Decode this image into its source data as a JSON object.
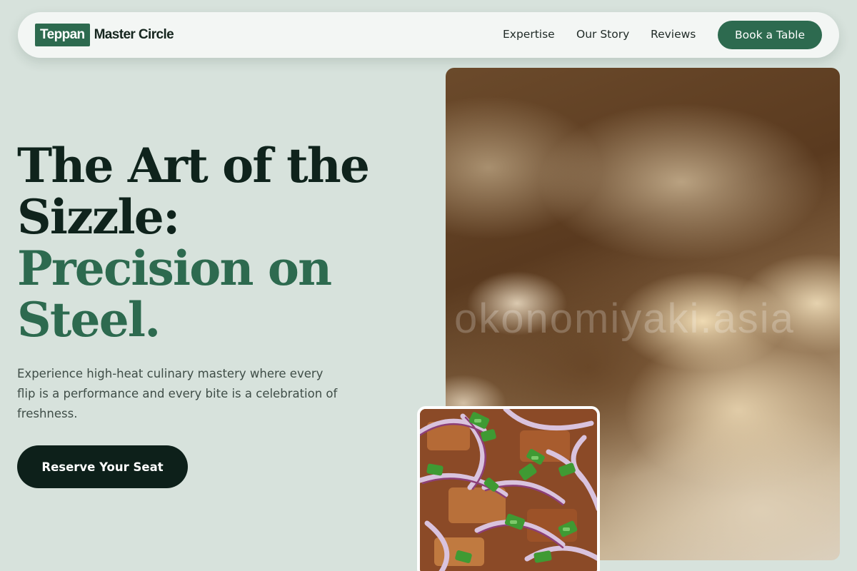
{
  "brand": {
    "badge": "Teppan",
    "name": "Master Circle",
    "accent_color": "#2d6a4f"
  },
  "nav": {
    "links": [
      {
        "label": "Expertise"
      },
      {
        "label": "Our Story"
      },
      {
        "label": "Reviews"
      }
    ],
    "cta_label": "Book a Table"
  },
  "hero": {
    "title_line1": "The Art of the",
    "title_line2": "Sizzle:",
    "title_accent_line1": "Precision on",
    "title_accent_line2": "Steel.",
    "description": "Experience high-heat culinary mastery where every flip is a performance and every bite is a celebration of freshness.",
    "cta_label": "Reserve Your Seat"
  },
  "images": {
    "main_watermark": "okonomiyaki.asia",
    "main_alt_icon": "cashew-nuts-photo",
    "inset_alt_icon": "okonomiyaki-topping-photo"
  },
  "colors": {
    "page_bg": "#d7e2dc",
    "dark": "#0d201a",
    "accent": "#2d6a4f"
  }
}
